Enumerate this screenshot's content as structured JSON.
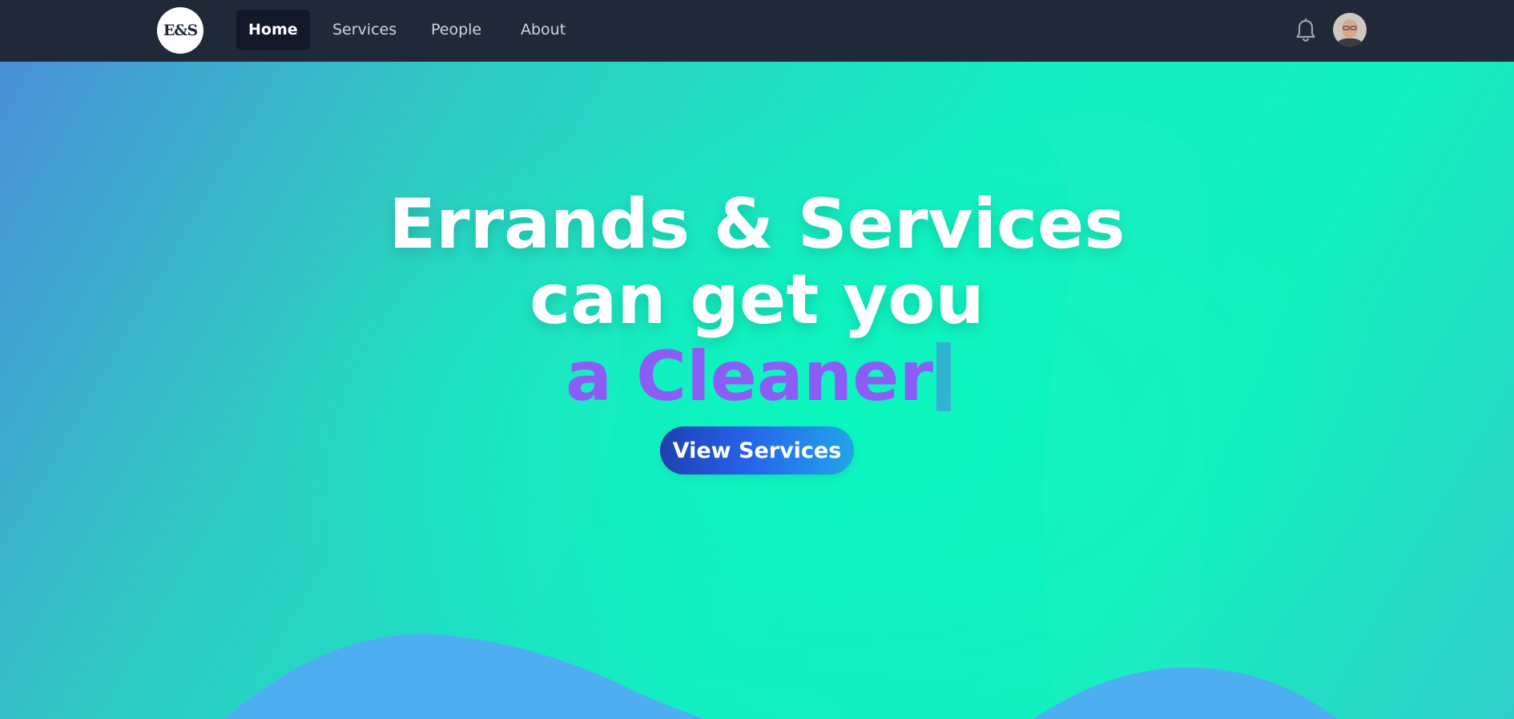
{
  "nav": {
    "logo_text": "E&S",
    "items": [
      {
        "label": "Home",
        "active": true
      },
      {
        "label": "Services",
        "active": false
      },
      {
        "label": "People",
        "active": false
      },
      {
        "label": "About",
        "active": false
      }
    ],
    "notification_icon": "bell-icon",
    "avatar_icon": "user-avatar"
  },
  "hero": {
    "line1": "Errands & Services",
    "line2": "can get you",
    "typed_text": "a Cleaner",
    "cta_label": "View Services"
  },
  "colors": {
    "navbar_bg": "#1f2937",
    "active_nav_bg": "#111827",
    "accent_purple": "#8b5cf6",
    "hero_teal": "#13f0bf",
    "wave_blue": "#4fadf2",
    "cta_blue": "#1e40af"
  }
}
